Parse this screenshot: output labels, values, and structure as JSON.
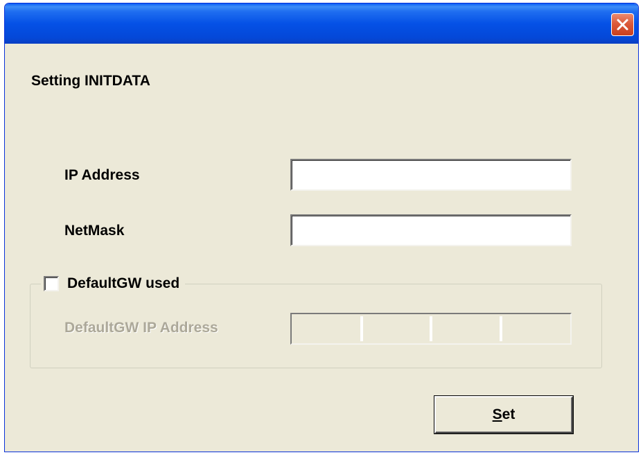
{
  "window": {
    "title": "",
    "close_icon": "close-icon"
  },
  "dialog": {
    "heading": "Setting INITDATA",
    "ip_address_label": "IP Address",
    "ip_address_value": "",
    "netmask_label": "NetMask",
    "netmask_value": "",
    "gateway_group": {
      "checkbox_label": "DefaultGW used",
      "checked": false,
      "gw_label": "DefaultGW IP Address",
      "octets": [
        "",
        "",
        "",
        ""
      ]
    },
    "set_button": {
      "mnemonic": "S",
      "rest": "et"
    }
  },
  "colors": {
    "titlebar": "#0551e6",
    "close_button": "#dc5a3a",
    "face": "#ece9d8",
    "disabled_text": "#aca899"
  }
}
